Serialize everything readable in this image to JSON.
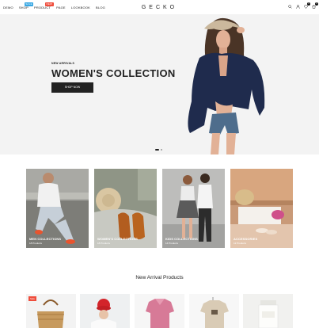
{
  "header": {
    "nav": [
      {
        "label": "DEMO"
      },
      {
        "label": "SHOP",
        "badge": "Sale",
        "badge_color": "blue"
      },
      {
        "label": "PRODUCT",
        "badge": "New",
        "badge_color": "red"
      },
      {
        "label": "PAGE"
      },
      {
        "label": "LOOKBOOK"
      },
      {
        "label": "BLOG"
      }
    ],
    "logo": "GECKO",
    "wishlist_count": "0",
    "cart_count": "0"
  },
  "hero": {
    "subtitle": "NEW ARRIVALS",
    "title": "WOMEN'S COLLECTION",
    "button": "SHOP NOW"
  },
  "categories": [
    {
      "name": "MEN COLLECTIONS",
      "count": "18 Products"
    },
    {
      "name": "WOMEN'S COLLECTIONS",
      "count": "18 Products"
    },
    {
      "name": "KIDS COLLECTIONS",
      "count": "14 Products"
    },
    {
      "name": "ACCESSORIES",
      "count": "12 Products"
    }
  ],
  "arrivals": {
    "title": "New Arrival Products",
    "sale_badge": "Sale"
  },
  "colors": {
    "accent_blue": "#37a7e3",
    "accent_red": "#ef4d3c",
    "dark": "#222222"
  }
}
